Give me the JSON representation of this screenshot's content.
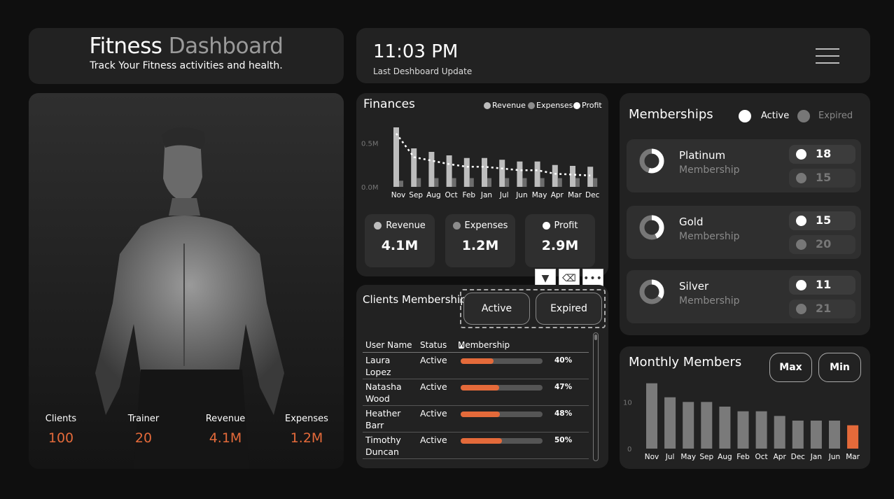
{
  "header": {
    "title_a": "Fitness",
    "title_b": "Dashboard",
    "subtitle": "Track Your Fitness activities and health."
  },
  "topbar": {
    "time": "11:03 PM",
    "caption": "Last Deshboard Update",
    "menu_icon": "hamburger-icon"
  },
  "hero_stats": [
    {
      "label": "Clients",
      "value": "100"
    },
    {
      "label": "Trainer",
      "value": "20"
    },
    {
      "label": "Revenue",
      "value": "4.1M"
    },
    {
      "label": "Expenses",
      "value": "1.2M"
    }
  ],
  "finances": {
    "title": "Finances",
    "legend": [
      "Revenue",
      "Expenses",
      "Profit"
    ],
    "kpis": [
      {
        "label": "Revenue",
        "value": "4.1M",
        "color": "#bdbdbd"
      },
      {
        "label": "Expenses",
        "value": "1.2M",
        "color": "#8c8c8c"
      },
      {
        "label": "Profit",
        "value": "2.9M",
        "color": "#ffffff"
      }
    ]
  },
  "clients_membership": {
    "title": "Clients Membership",
    "toggle": [
      "Active",
      "Expired"
    ],
    "columns": [
      "User Name",
      "Status",
      "Membership"
    ],
    "rows": [
      {
        "name": "Laura Lopez",
        "status": "Active",
        "pct": 40,
        "pct_label": "40%"
      },
      {
        "name": "Natasha Wood",
        "status": "Active",
        "pct": 47,
        "pct_label": "47%"
      },
      {
        "name": "Heather Barr",
        "status": "Active",
        "pct": 48,
        "pct_label": "48%"
      },
      {
        "name": "Timothy Duncan",
        "status": "Active",
        "pct": 50,
        "pct_label": "50%"
      }
    ],
    "tools": [
      "filter-icon",
      "eraser-icon",
      "more-icon"
    ]
  },
  "memberships": {
    "title": "Memberships",
    "legend": [
      "Active",
      "Expired"
    ],
    "items": [
      {
        "name": "Platinum",
        "sub": "Membership",
        "active": "18",
        "expired": "15"
      },
      {
        "name": "Gold",
        "sub": "Membership",
        "active": "15",
        "expired": "20"
      },
      {
        "name": "Silver",
        "sub": "Membership",
        "active": "11",
        "expired": "21"
      }
    ]
  },
  "monthly": {
    "title": "Monthly Members",
    "buttons": [
      "Max",
      "Min"
    ]
  },
  "colors": {
    "accent": "#e46a3a",
    "card": "#222222",
    "bg": "#0f0f0f"
  },
  "chart_data": [
    {
      "type": "bar",
      "title": "Finances",
      "categories": [
        "Nov",
        "Sep",
        "Aug",
        "Oct",
        "Feb",
        "Jan",
        "Jul",
        "Jun",
        "May",
        "Apr",
        "Mar",
        "Dec"
      ],
      "series": [
        {
          "name": "Revenue",
          "values": [
            0.68,
            0.44,
            0.4,
            0.36,
            0.33,
            0.33,
            0.31,
            0.29,
            0.29,
            0.25,
            0.24,
            0.23
          ]
        },
        {
          "name": "Expenses",
          "values": [
            0.07,
            0.1,
            0.1,
            0.1,
            0.1,
            0.1,
            0.1,
            0.1,
            0.1,
            0.1,
            0.1,
            0.1
          ]
        },
        {
          "name": "Profit",
          "values": [
            0.61,
            0.34,
            0.3,
            0.26,
            0.23,
            0.23,
            0.21,
            0.19,
            0.19,
            0.15,
            0.14,
            0.13
          ]
        }
      ],
      "yticks": [
        "0.0M",
        "0.5M"
      ],
      "ylim": [
        0,
        0.8
      ]
    },
    {
      "type": "bar",
      "title": "Monthly Members",
      "categories": [
        "Nov",
        "Jul",
        "May",
        "Sep",
        "Aug",
        "Feb",
        "Oct",
        "Apr",
        "Dec",
        "Jan",
        "Jun",
        "Mar"
      ],
      "values": [
        14,
        11,
        10,
        10,
        9,
        8,
        8,
        7,
        6,
        6,
        6,
        5
      ],
      "yticks": [
        "0",
        "10"
      ],
      "ylim": [
        0,
        15
      ]
    }
  ]
}
